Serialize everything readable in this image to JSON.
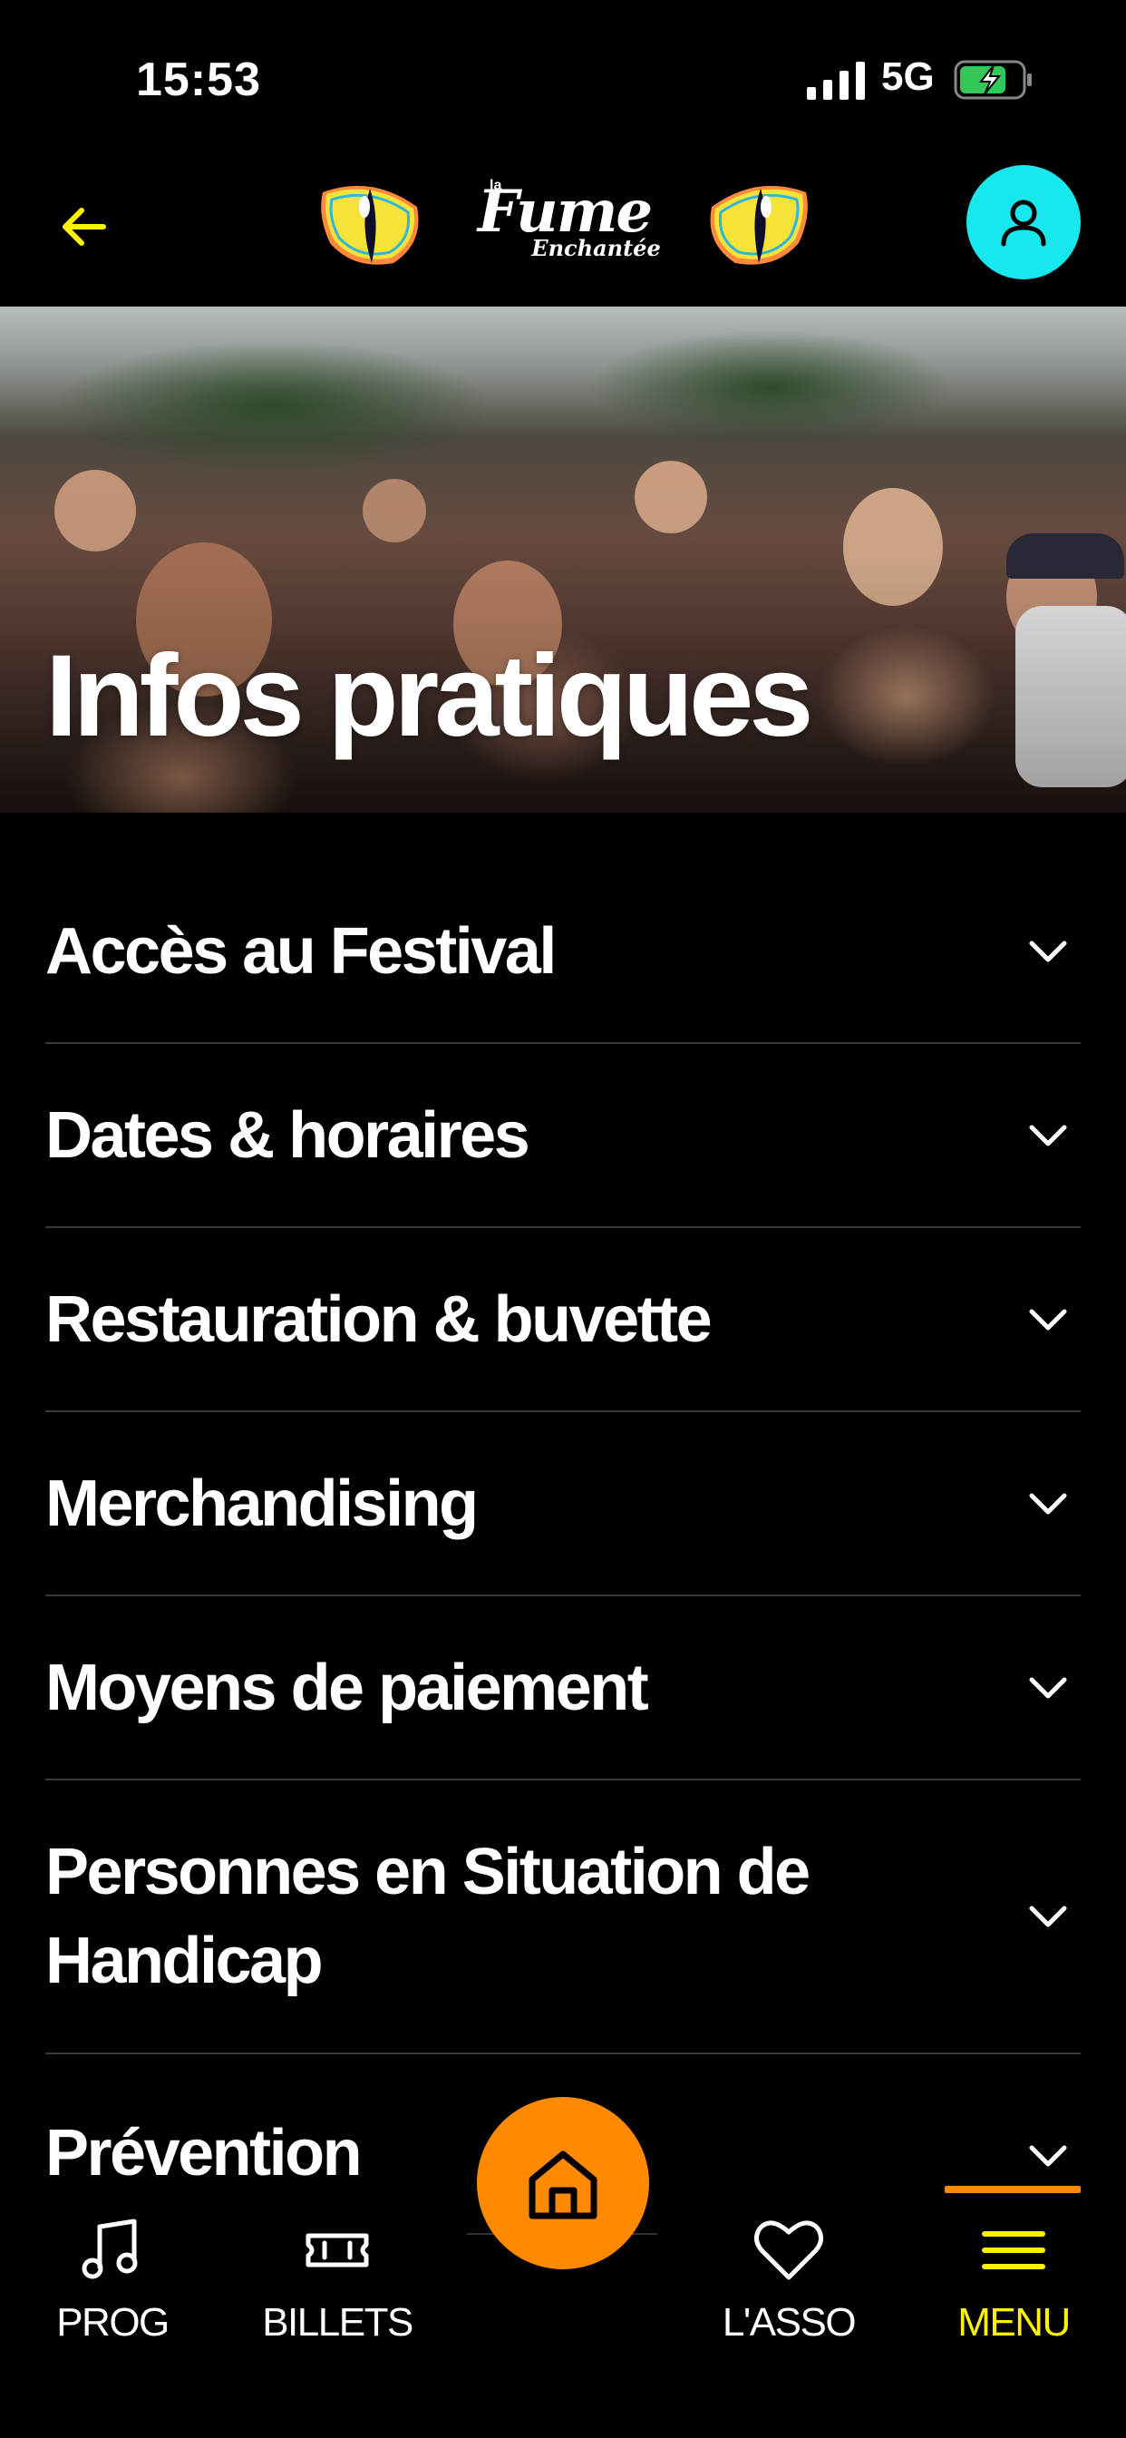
{
  "status_bar": {
    "time": "15:53",
    "network": "5G",
    "icons": [
      "signal-icon",
      "battery-charging-icon"
    ]
  },
  "header": {
    "back_icon": "arrow-left-icon",
    "logo": {
      "prefix": "la",
      "main": "Fume",
      "sub": "Enchantée"
    },
    "profile_icon": "user-icon",
    "colors": {
      "accent": "#fff200",
      "profile_bg": "#16e8ee"
    }
  },
  "hero": {
    "title": "Infos pratiques"
  },
  "faq": {
    "items": [
      {
        "label": "Accès au Festival",
        "icon": "chevron-down-icon"
      },
      {
        "label": "Dates & horaires",
        "icon": "chevron-down-icon"
      },
      {
        "label": "Restauration & buvette",
        "icon": "chevron-down-icon"
      },
      {
        "label": "Merchandising",
        "icon": "chevron-down-icon"
      },
      {
        "label": "Moyens de paiement",
        "icon": "chevron-down-icon"
      },
      {
        "label": "Personnes en Situation de Handicap",
        "icon": "chevron-down-icon"
      },
      {
        "label": "Prévention",
        "icon": "chevron-down-icon"
      }
    ]
  },
  "bottom_nav": {
    "items": [
      {
        "label": "PROG",
        "icon": "music-note-icon"
      },
      {
        "label": "BILLETS",
        "icon": "ticket-icon"
      },
      {
        "label": "L'ASSO",
        "icon": "heart-icon"
      },
      {
        "label": "MENU",
        "icon": "menu-icon",
        "active": true
      }
    ],
    "home_icon": "home-icon",
    "colors": {
      "fab": "#ff8a00",
      "active": "#fff200"
    }
  }
}
